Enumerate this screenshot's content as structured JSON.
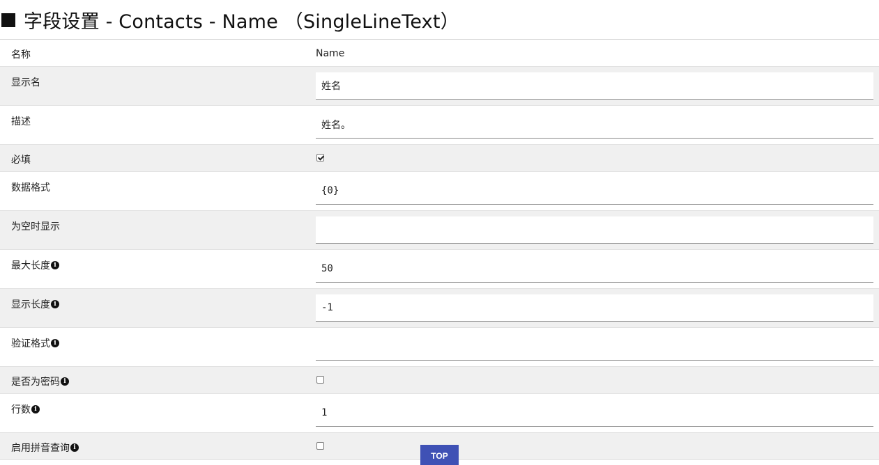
{
  "header": {
    "title": "字段设置 - Contacts - Name （SingleLineText）"
  },
  "fields": {
    "name": {
      "label": "名称",
      "value": "Name"
    },
    "display_name": {
      "label": "显示名",
      "value": "姓名"
    },
    "description": {
      "label": "描述",
      "value": "姓名。"
    },
    "required": {
      "label": "必填",
      "checked": true
    },
    "data_format": {
      "label": "数据格式",
      "value": "{0}"
    },
    "empty_display": {
      "label": "为空时显示",
      "value": ""
    },
    "max_length": {
      "label": "最大长度",
      "value": "50",
      "info_icon": "info-icon"
    },
    "display_length": {
      "label": "显示长度",
      "value": "-1",
      "info_icon": "info-icon"
    },
    "validation_format": {
      "label": "验证格式",
      "value": "",
      "info_icon": "info-icon"
    },
    "is_password": {
      "label": "是否为密码",
      "checked": false,
      "info_icon": "info-icon"
    },
    "rows": {
      "label": "行数",
      "value": "1",
      "info_icon": "info-icon"
    },
    "pinyin_search": {
      "label": "启用拼音查询",
      "checked": false,
      "info_icon": "info-icon"
    }
  },
  "top_button": {
    "label": "TOP"
  },
  "colors": {
    "alt_row": "#f0f0f0",
    "top_button": "#3f51b5"
  }
}
